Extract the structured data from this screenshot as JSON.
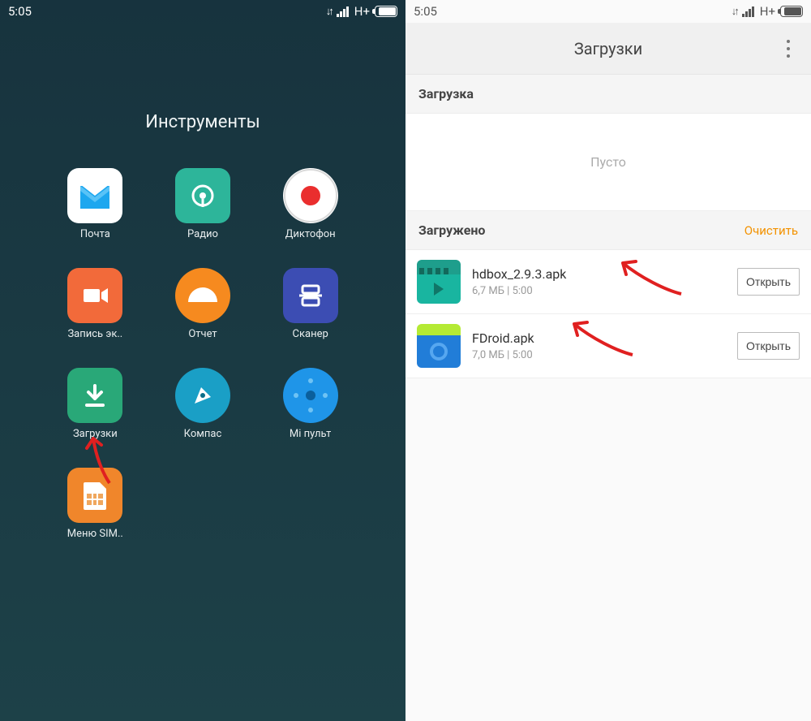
{
  "statusbar": {
    "time": "5:05",
    "network_label": "H+"
  },
  "left_panel": {
    "folder_title": "Инструменты",
    "apps": [
      {
        "id": "mail",
        "label": "Почта"
      },
      {
        "id": "radio",
        "label": "Радио"
      },
      {
        "id": "recorder",
        "label": "Диктофон"
      },
      {
        "id": "screenrec",
        "label": "Запись эк.."
      },
      {
        "id": "report",
        "label": "Отчет"
      },
      {
        "id": "scanner",
        "label": "Сканер"
      },
      {
        "id": "downloads",
        "label": "Загрузки"
      },
      {
        "id": "compass",
        "label": "Компас"
      },
      {
        "id": "miremote",
        "label": "Mi пульт"
      },
      {
        "id": "simmenu",
        "label": "Меню SIM.."
      }
    ]
  },
  "right_panel": {
    "title": "Загрузки",
    "section_in_progress": "Загрузка",
    "empty_text": "Пусто",
    "section_done": "Загружено",
    "clear_action": "Очистить",
    "open_button": "Открыть",
    "items": [
      {
        "name": "hdbox_2.9.3.apk",
        "meta": "6,7 МБ | 5:00",
        "thumb": "hdbox"
      },
      {
        "name": "FDroid.apk",
        "meta": "7,0 МБ | 5:00",
        "thumb": "fdroid"
      }
    ]
  }
}
